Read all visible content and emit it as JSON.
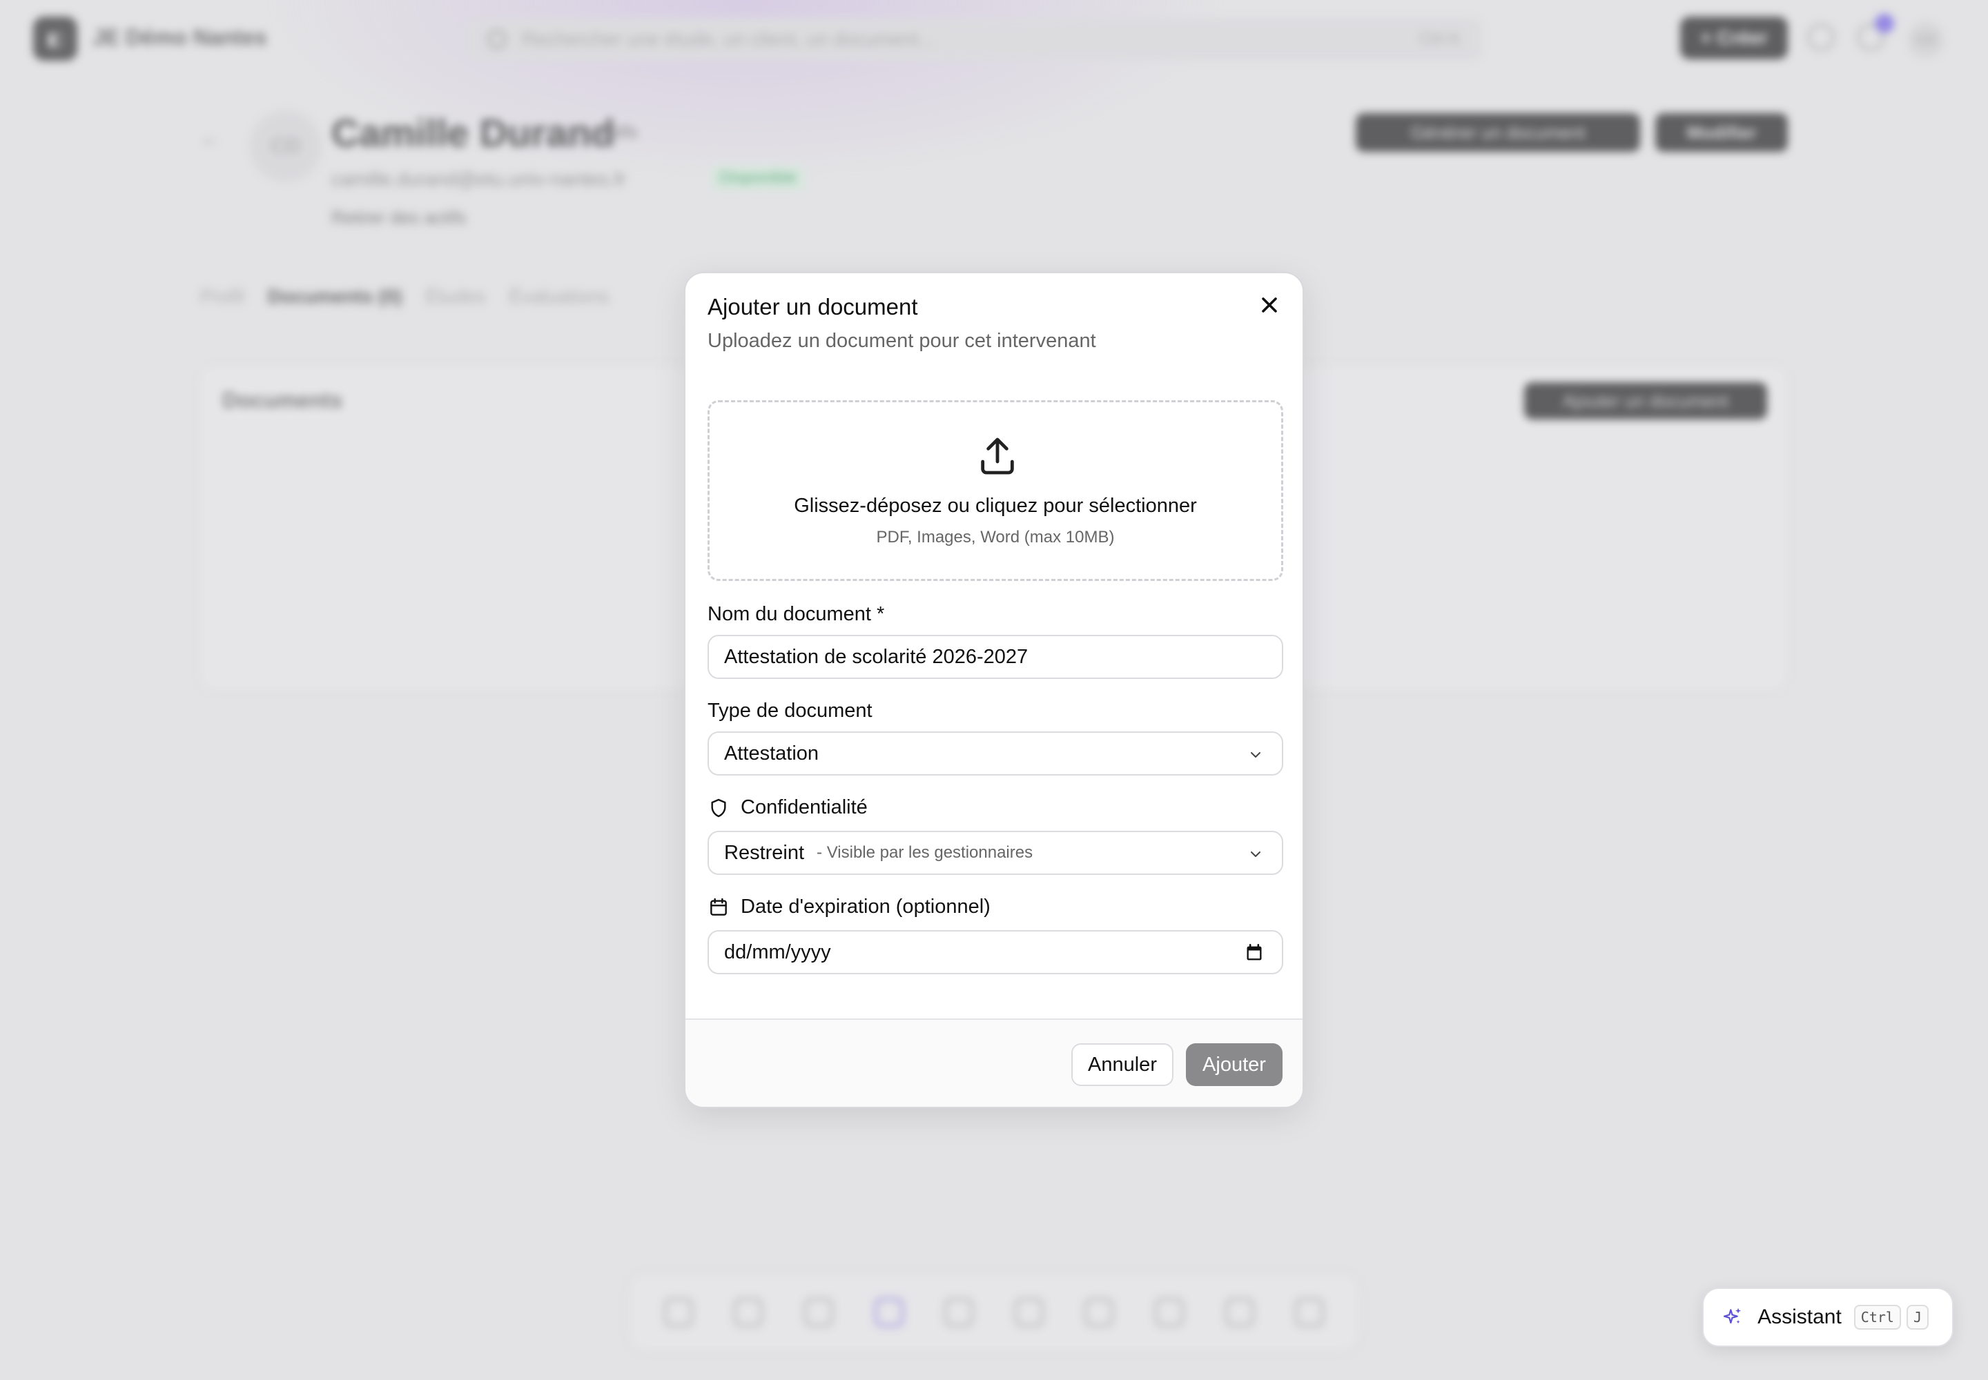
{
  "app": {
    "workspace": "JE Démo Nantes",
    "search_placeholder": "Rechercher une étude, un client, un document...",
    "search_shortcut": "Ctrl K",
    "create_label": "+ Créer",
    "user_initials": "CD"
  },
  "profile": {
    "initials": "CD",
    "name": "Camille Durand",
    "role": "Actifs",
    "email": "camille.durand@etu.univ-nantes.fr",
    "status": "Disponible",
    "action": "Retirer des actifs",
    "generate_button": "Générer un document",
    "edit_button": "Modifier"
  },
  "tabs": [
    "Profil",
    "Documents (0)",
    "Études",
    "Évaluations"
  ],
  "documents_card": {
    "title": "Documents",
    "add_button": "Ajouter un document"
  },
  "dock": {
    "items": [
      "dashboard",
      "messages",
      "briefcase",
      "people",
      "globe",
      "calendar",
      "clipboard",
      "document",
      "tools",
      "settings"
    ],
    "active_index": 3
  },
  "modal": {
    "title": "Ajouter un document",
    "subtitle": "Uploadez un document pour cet intervenant",
    "dropzone": {
      "main": "Glissez-déposez ou cliquez pour sélectionner",
      "sub": "PDF, Images, Word (max 10MB)"
    },
    "name_field": {
      "label": "Nom du document *",
      "value": "Attestation de scolarité 2026-2027"
    },
    "type_field": {
      "label": "Type de document",
      "value": "Attestation"
    },
    "confidentiality_field": {
      "label": "Confidentialité",
      "value": "Restreint",
      "hint": "- Visible par les gestionnaires"
    },
    "expiration_field": {
      "label": "Date d'expiration (optionnel)",
      "placeholder": "dd/mm/yyyy"
    },
    "cancel_label": "Annuler",
    "submit_label": "Ajouter"
  },
  "assistant": {
    "label": "Assistant",
    "key1": "Ctrl",
    "key2": "J"
  },
  "colors": {
    "accent": "#8c7be8",
    "submit_disabled": "#8a8a8c",
    "notification": "#6d5ce7"
  }
}
